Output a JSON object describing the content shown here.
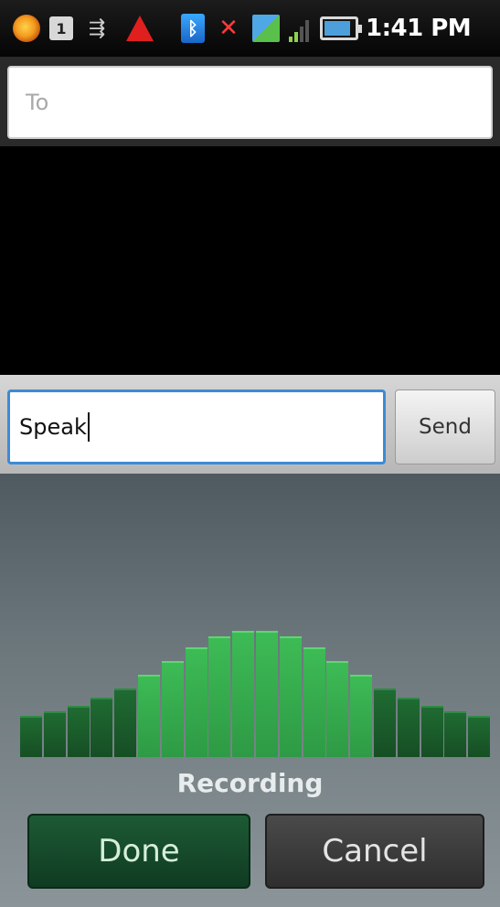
{
  "status_bar": {
    "time": "1:41 PM",
    "icons": [
      "firefox-icon",
      "sd-card-icon",
      "usb-icon",
      "warning-icon",
      "bluetooth-icon",
      "mute-icon",
      "data-sync-icon",
      "signal-icon",
      "battery-icon"
    ],
    "sd_glyph": "1",
    "usb_glyph": "⇶",
    "bt_glyph": "ᛒ",
    "mute_glyph": "✕"
  },
  "compose": {
    "to_placeholder": "To",
    "message_text": "Speak",
    "send_label": "Send"
  },
  "voice_input": {
    "status": "Recording",
    "done_label": "Done",
    "cancel_label": "Cancel",
    "level_bars": [
      0.3,
      0.33,
      0.37,
      0.43,
      0.5,
      0.6,
      0.7,
      0.8,
      0.88,
      0.92,
      0.92,
      0.88,
      0.8,
      0.7,
      0.6,
      0.5,
      0.43,
      0.37,
      0.33,
      0.3
    ],
    "colors": {
      "bar_dark": "#1f6b32",
      "bar_light": "#3dbb55"
    }
  }
}
